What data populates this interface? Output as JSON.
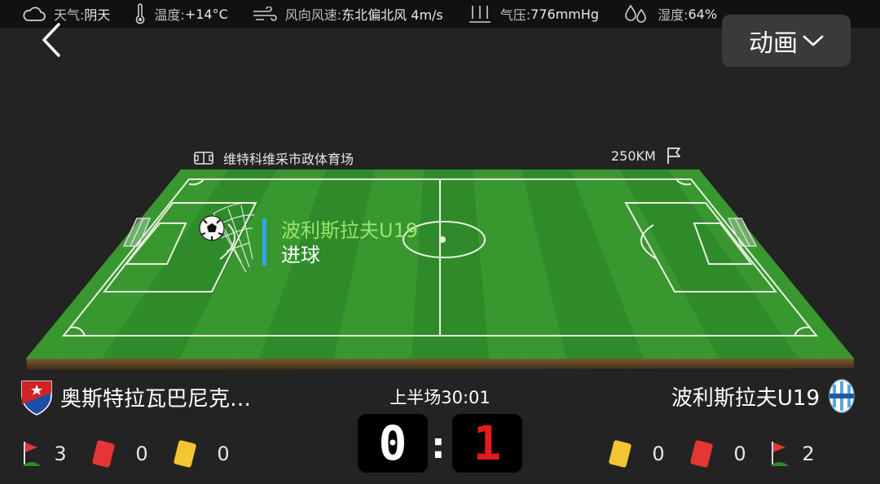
{
  "weather": {
    "condition_label": "天气:",
    "condition_value": "阴天",
    "temp_label": "温度:",
    "temp_value": "+14°C",
    "wind_label": "风向风速:",
    "wind_value": "东北偏北风 4m/s",
    "pressure_label": "气压:",
    "pressure_value": "776mmHg",
    "humidity_label": "湿度:",
    "humidity_value": "64%"
  },
  "header": {
    "animation_label": "动画"
  },
  "pitch": {
    "stadium": "维特科维采市政体育场",
    "distance": "250KM"
  },
  "event": {
    "team": "波利斯拉夫U19",
    "type": "进球"
  },
  "match": {
    "period": "上半场30:01",
    "home_team": "奥斯特拉瓦巴尼克…",
    "away_team": "波利斯拉夫U19",
    "home_score": "0",
    "separator": ":",
    "away_score": "1"
  },
  "stats": {
    "home": {
      "corners": "3",
      "red_cards": "0",
      "yellow_cards": "0"
    },
    "away": {
      "yellow_cards": "0",
      "red_cards": "0",
      "corners": "2"
    }
  },
  "colors": {
    "accent_blue": "#3aa0f5",
    "team_highlight": "#9be46a",
    "away_score": "#e21a1a",
    "red_card": "#e53535",
    "yellow_card": "#f3c531"
  }
}
